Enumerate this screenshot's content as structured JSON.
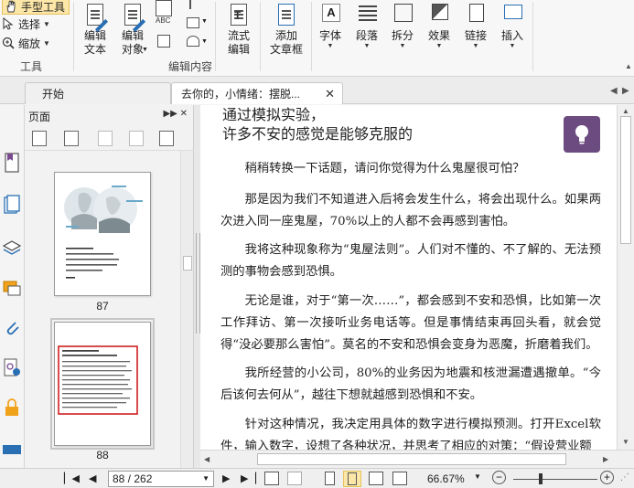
{
  "ribbon": {
    "tools_group": {
      "hand_label": "手型工具",
      "select_label": "选择",
      "zoom_label": "缩放",
      "group_label": "工具"
    },
    "edit_group": {
      "edit_text_label": "编辑\n文本",
      "edit_object_label": "编辑\n对象",
      "group_label": "编辑内容"
    },
    "flow_edit_label": "流式\n编辑",
    "add_textbox_label": "添加\n文章框",
    "font_label": "字体",
    "paragraph_label": "段落",
    "split_label": "拆分",
    "effect_label": "效果",
    "link_label": "链接",
    "insert_label": "插入"
  },
  "tabs": [
    {
      "label": "开始"
    },
    {
      "label": "去你的，小情绪：摆脱..."
    }
  ],
  "panel": {
    "title": "页面",
    "pages": [
      {
        "number": "87"
      },
      {
        "number": "88"
      }
    ]
  },
  "document": {
    "title_line1": "通过模拟实验，",
    "title_line2": "许多不安的感觉是能够克服的",
    "paragraphs": [
      "稍稍转换一下话题，请问你觉得为什么鬼屋很可怕？",
      "那是因为我们不知道进入后将会发生什么，将会出现什么。如果两次进入同一座鬼屋，70%以上的人都不会再感到害怕。",
      "我将这种现象称为“鬼屋法则”。人们对不懂的、不了解的、无法预测的事物会感到恐惧。",
      "无论是谁，对于“第一次……”，都会感到不安和恐惧，比如第一次工作拜访、第一次接听业务电话等。但是事情结束再回头看，就会觉得“没必要那么害怕”。莫名的不安和恐惧会变身为恶魔，折磨着我们。",
      "我所经营的小公司，80%的业务因为地震和核泄漏遭遇撤单。“今后该何去何从”，越往下想就越感到恐惧和不安。",
      "针对这种情况，我决定用具体的数字进行模拟预测。打开Excel软件，输入数字，设想了各种状况，并思考了相应的对策：“假设营业额"
    ]
  },
  "status": {
    "page_value": "88 / 262",
    "zoom_value": "66.67%"
  },
  "colors": {
    "accent_purple": "#6c4b80",
    "selected_red": "#d12020",
    "hand_tool_active": "#fde7a8"
  }
}
